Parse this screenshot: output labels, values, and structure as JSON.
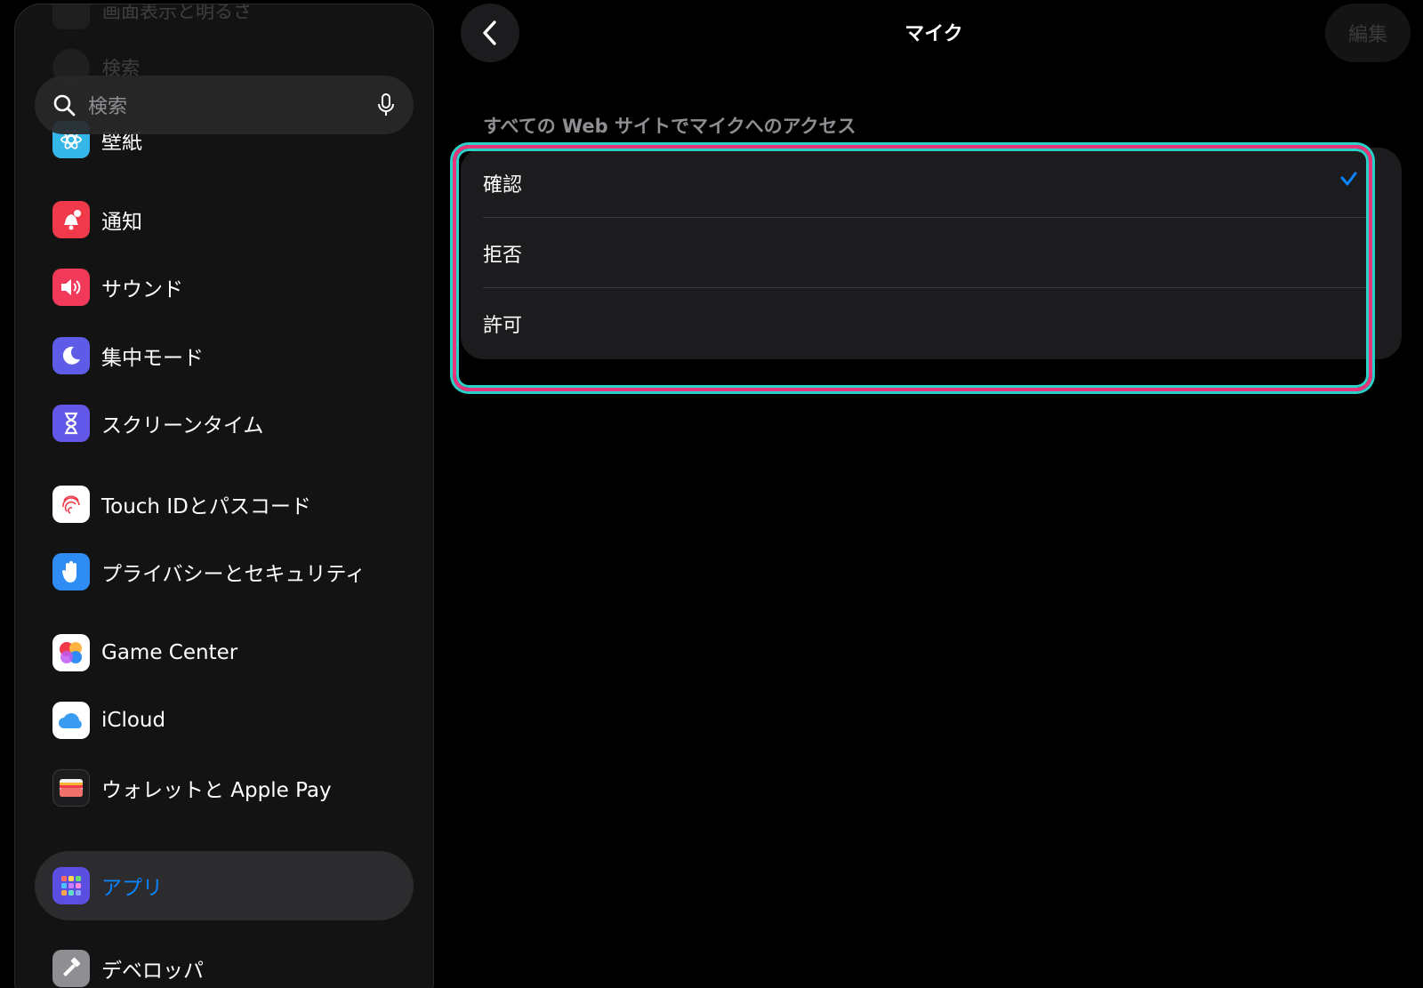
{
  "sidebar": {
    "ghost_items": [
      {
        "label": "画面表示と明るさ",
        "icon": "sun-icon"
      },
      {
        "label": "検索",
        "icon": "search-icon"
      }
    ],
    "search": {
      "placeholder": "検索",
      "icon": "search-icon",
      "mic_icon": "mic-icon"
    },
    "items": [
      {
        "label": "壁紙",
        "icon": "flower-icon",
        "color": "#35b6e8"
      },
      {
        "label": "通知",
        "icon": "bell-icon",
        "color": "#f0394a"
      },
      {
        "label": "サウンド",
        "icon": "speaker-icon",
        "color": "#f1395a"
      },
      {
        "label": "集中モード",
        "icon": "moon-icon",
        "color": "#5e5ce6"
      },
      {
        "label": "スクリーンタイム",
        "icon": "hourglass-icon",
        "color": "#6157e8"
      },
      {
        "label": "Touch IDとパスコード",
        "icon": "fingerprint-icon",
        "color": "#ffffff"
      },
      {
        "label": "プライバシーとセキュリティ",
        "icon": "hand-icon",
        "color": "#2f8cf5"
      },
      {
        "label": "Game Center",
        "icon": "game-center-icon",
        "color": "#ffffff"
      },
      {
        "label": "iCloud",
        "icon": "cloud-icon",
        "color": "#ffffff"
      },
      {
        "label": "ウォレットと Apple Pay",
        "icon": "wallet-icon",
        "color": "#1c1c1e"
      },
      {
        "label": "アプリ",
        "icon": "apps-grid-icon",
        "color": "#5a4fe0",
        "selected": true
      },
      {
        "label": "デベロッパ",
        "icon": "hammer-icon",
        "color": "#8e8e93"
      }
    ]
  },
  "header": {
    "title": "マイク",
    "edit_label": "編集",
    "back_icon": "chevron-left-icon"
  },
  "section": {
    "header": "すべての Web サイトでマイクへのアクセス"
  },
  "options": [
    {
      "label": "確認",
      "checked": true
    },
    {
      "label": "拒否",
      "checked": false
    },
    {
      "label": "許可",
      "checked": false
    }
  ],
  "colors": {
    "accent": "#0a84ff",
    "highlight_outer": "#e8357a",
    "highlight_inner": "#2ad1c9"
  }
}
